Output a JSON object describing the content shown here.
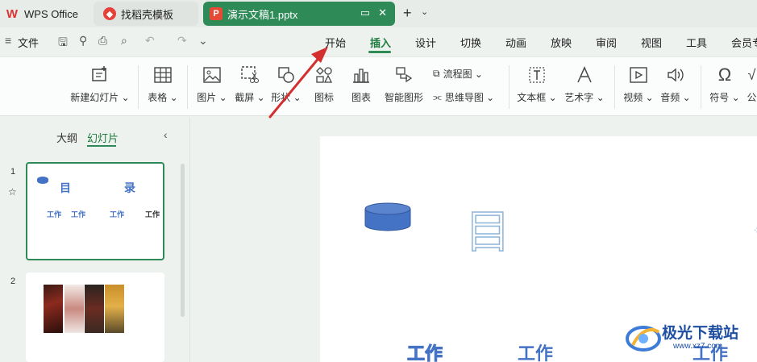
{
  "tabs": [
    {
      "label": "WPS Office",
      "icon": "wps-logo-icon"
    },
    {
      "label": "找稻壳模板",
      "icon": "docer-logo-icon"
    },
    {
      "label": "演示文稿1.pptx",
      "icon": "presentation-file-icon"
    }
  ],
  "menu": {
    "file": "文件",
    "items": [
      "开始",
      "插入",
      "设计",
      "切换",
      "动画",
      "放映",
      "审阅",
      "视图",
      "工具",
      "会员专"
    ],
    "active": "插入"
  },
  "ribbon": {
    "new_slide": "新建幻灯片",
    "table": "表格",
    "picture": "图片",
    "screenshot": "截屏",
    "shape": "形状",
    "icons": "图标",
    "chart": "图表",
    "smart_art": "智能图形",
    "flowchart": "流程图",
    "mindmap": "思维导图",
    "textbox": "文本框",
    "wordart": "艺术字",
    "video": "视频",
    "audio": "音频",
    "symbol": "符号",
    "formula": "公"
  },
  "left_panel": {
    "tab_outline": "大纲",
    "tab_slides": "幻灯片",
    "slides": [
      {
        "number": "1",
        "title_left": "目",
        "title_right": "录",
        "items": [
          "工作",
          "工作",
          "工作",
          "工作"
        ]
      },
      {
        "number": "2"
      }
    ]
  },
  "slide": {
    "title_char": "目",
    "bottom_texts": [
      "工作",
      "工作",
      "工作"
    ],
    "shape_color": "#4472c4"
  },
  "watermark": {
    "text": "极光下载站",
    "url": "www.xz7.com"
  },
  "colors": {
    "accent": "#2e8b57",
    "arrow": "#d32f2f"
  }
}
